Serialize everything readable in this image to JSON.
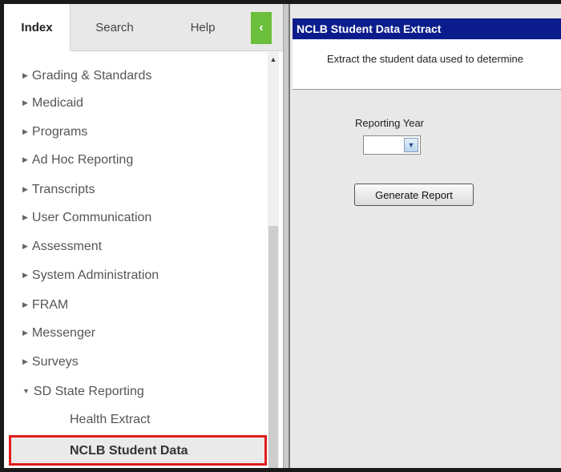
{
  "tabs": [
    {
      "label": "Index"
    },
    {
      "label": "Search"
    },
    {
      "label": "Help"
    }
  ],
  "collapse_glyph": "‹",
  "tree": {
    "items": [
      {
        "label": "Grading & Standards"
      },
      {
        "label": "Medicaid"
      },
      {
        "label": "Programs"
      },
      {
        "label": "Ad Hoc Reporting"
      },
      {
        "label": "Transcripts"
      },
      {
        "label": "User Communication"
      },
      {
        "label": "Assessment"
      },
      {
        "label": "System Administration"
      },
      {
        "label": "FRAM"
      },
      {
        "label": "Messenger"
      },
      {
        "label": "Surveys"
      },
      {
        "label": "SD State Reporting"
      }
    ],
    "subitems": [
      {
        "label": "Health Extract"
      },
      {
        "label": "NCLB Student Data"
      }
    ]
  },
  "tool": {
    "title": "NCLB Student Data Extract",
    "description": "Extract the student data used to determine",
    "reporting_year_label": "Reporting Year",
    "reporting_year_value": "",
    "generate_button": "Generate Report"
  },
  "colors": {
    "title_bar": "#0b1d8c",
    "collapse_button": "#6bbf3b",
    "highlight_border": "#e01b1b"
  }
}
